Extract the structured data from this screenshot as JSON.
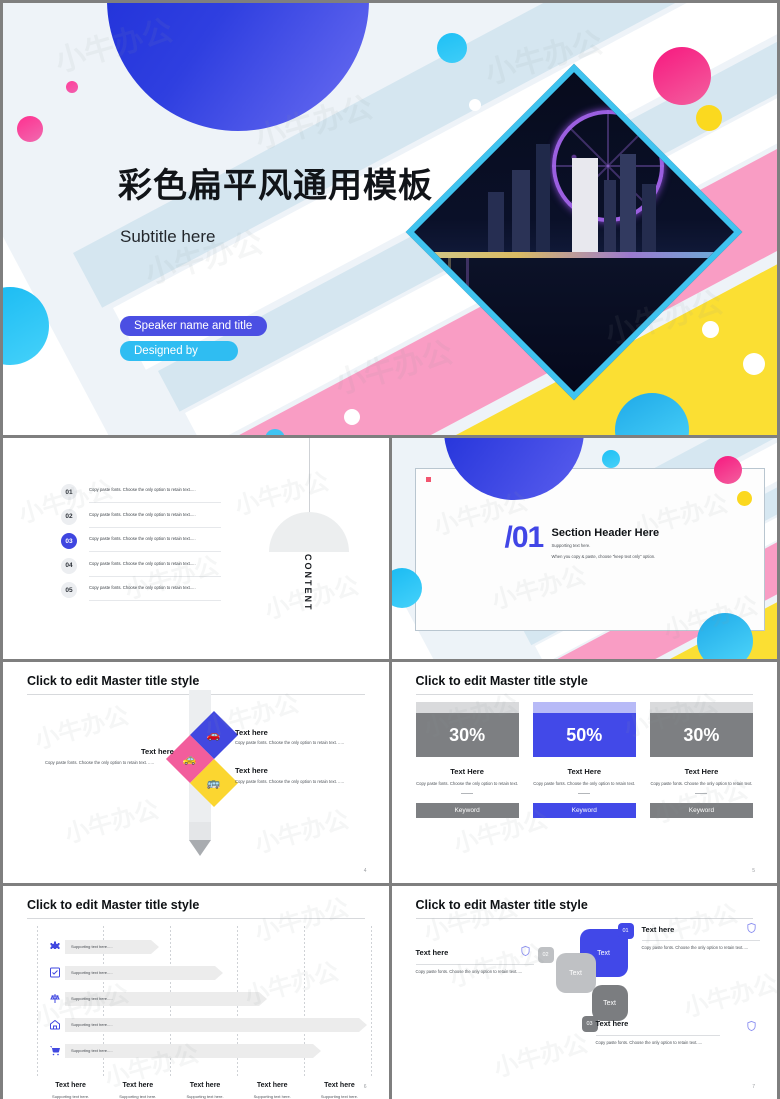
{
  "deck": {
    "title_slide": {
      "title": "彩色扁平风通用模板",
      "subtitle": "Subtitle here",
      "speaker_badge": "Speaker name and title",
      "designed_badge": "Designed by",
      "accent_blue": "#2233dd",
      "accent_pink": "#f6187f",
      "accent_cyan": "#2fbdf2",
      "accent_yellow": "#fbdf33"
    },
    "toc_slide": {
      "content_label": "CONTENT",
      "items": [
        {
          "num": "01",
          "text": "Copy paste fonts. Choose the only option to retain text....."
        },
        {
          "num": "02",
          "text": "Copy paste fonts. Choose the only option to retain text....."
        },
        {
          "num": "03",
          "text": "Copy paste fonts. Choose the only option to retain text....."
        },
        {
          "num": "04",
          "text": "Copy paste fonts. Choose the only option to retain text....."
        },
        {
          "num": "05",
          "text": "Copy paste fonts. Choose the only option to retain text....."
        }
      ],
      "active_index": 2
    },
    "section_slide": {
      "number": "/01",
      "header": "Section Header Here",
      "line1": "Supporting text here.",
      "line2": "When you copy & paste, choose \"keep text only\" option."
    },
    "pencil_slide": {
      "title": "Click to edit Master title style",
      "page": "4",
      "items": [
        {
          "heading": "Text here",
          "body": "Copy paste fonts. Choose the only option to retain text. ....."
        },
        {
          "heading": "Text here",
          "body": "Copy paste fonts. Choose the only option to retain text. ....."
        },
        {
          "heading": "Text here",
          "body": "Copy paste fonts. Choose the only option to retain text. ....."
        }
      ],
      "icons": [
        "car-icon",
        "taxi-icon",
        "bus-icon"
      ]
    },
    "percent_slide": {
      "title": "Click to edit Master title style",
      "page": "5",
      "columns": [
        {
          "value": "30%",
          "heading": "Text Here",
          "body": "Copy paste fonts. Choose the only option to retain text.",
          "keyword": "Keyword",
          "highlight": false
        },
        {
          "value": "50%",
          "heading": "Text Here",
          "body": "Copy paste fonts. Choose the only option to retain text.",
          "keyword": "Keyword",
          "highlight": true
        },
        {
          "value": "30%",
          "heading": "Text Here",
          "body": "Copy paste fonts. Choose the only option to retain text.",
          "keyword": "Keyword",
          "highlight": false
        }
      ]
    },
    "bars_slide": {
      "title": "Click to edit Master title style",
      "page": "6",
      "rows": [
        {
          "icon": "puzzle-icon",
          "text": "Supporting text here....."
        },
        {
          "icon": "checkbox-icon",
          "text": "Supporting text here....."
        },
        {
          "icon": "scales-icon",
          "text": "Supporting text here....."
        },
        {
          "icon": "home-icon",
          "text": "Supporting text here....."
        },
        {
          "icon": "cart-icon",
          "text": "Supporting text here....."
        }
      ],
      "footers": [
        {
          "heading": "Text here",
          "sub": "Supporting text here."
        },
        {
          "heading": "Text here",
          "sub": "Supporting text here."
        },
        {
          "heading": "Text here",
          "sub": "Supporting text here."
        },
        {
          "heading": "Text here",
          "sub": "Supporting text here."
        },
        {
          "heading": "Text here",
          "sub": "Supporting text here."
        }
      ]
    },
    "cascade_slide": {
      "title": "Click to edit Master title style",
      "page": "7",
      "squares": [
        {
          "label": "Text",
          "badge": "01",
          "color": "#4148e8"
        },
        {
          "label": "Text",
          "badge": "02",
          "color": "#bfc1c4"
        },
        {
          "label": "Text",
          "badge": "03",
          "color": "#7b7d80"
        }
      ],
      "callouts": [
        {
          "heading": "Text here",
          "body": "Copy paste fonts. Choose the only option to retain text....."
        },
        {
          "heading": "Text here",
          "body": "Copy paste fonts. Choose the only option to retain text....."
        },
        {
          "heading": "Text here",
          "body": "Copy paste fonts. Choose the only option to retain text....."
        }
      ]
    }
  },
  "chart_data": {
    "type": "bar",
    "title": "Click to edit Master title style",
    "categories": [
      "Text here",
      "Text here",
      "Text here",
      "Text here",
      "Text here"
    ],
    "series": [
      {
        "name": "Supporting text here.....",
        "values": [
          1.1,
          2.1,
          2.8,
          4.3,
          3.6
        ]
      }
    ],
    "xlabel": "",
    "ylabel": "",
    "xlim": [
      0,
      5
    ],
    "grid": true,
    "legend": "none"
  },
  "watermark": "小牛办公"
}
